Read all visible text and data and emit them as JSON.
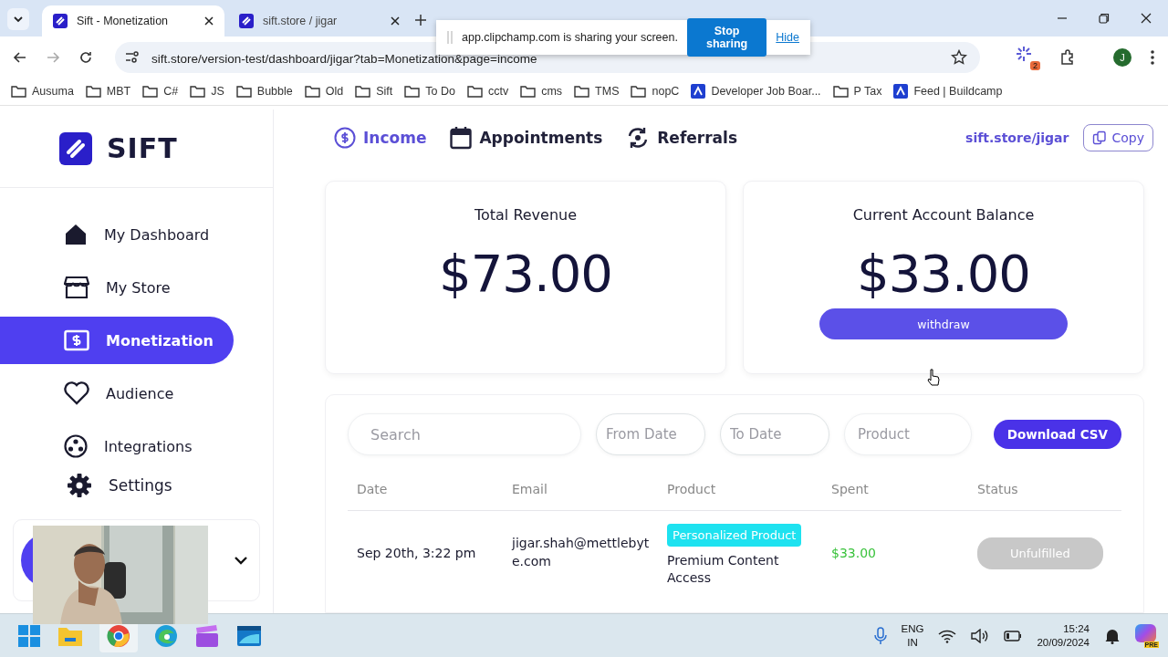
{
  "browser": {
    "tabs": [
      {
        "title": "Sift - Monetization",
        "selected": true
      },
      {
        "title": "sift.store / jigar",
        "selected": false
      }
    ],
    "address": "sift.store/version-test/dashboard/jigar?tab=Monetization&page=income",
    "bookmarks": [
      {
        "label": "Ausuma",
        "kind": "folder"
      },
      {
        "label": "MBT",
        "kind": "folder"
      },
      {
        "label": "C#",
        "kind": "folder"
      },
      {
        "label": "JS",
        "kind": "folder"
      },
      {
        "label": "Bubble",
        "kind": "folder"
      },
      {
        "label": "Old",
        "kind": "folder"
      },
      {
        "label": "Sift",
        "kind": "folder"
      },
      {
        "label": "To Do",
        "kind": "folder"
      },
      {
        "label": "cctv",
        "kind": "folder"
      },
      {
        "label": "cms",
        "kind": "folder"
      },
      {
        "label": "TMS",
        "kind": "folder"
      },
      {
        "label": "nopC",
        "kind": "folder"
      },
      {
        "label": "Developer Job Boar...",
        "kind": "site"
      },
      {
        "label": "P Tax",
        "kind": "folder"
      },
      {
        "label": "Feed | Buildcamp",
        "kind": "site"
      }
    ],
    "extension_badge": "2",
    "profile_initial": "J"
  },
  "share_bar": {
    "message": "app.clipchamp.com is sharing your screen.",
    "stop_button": "Stop sharing",
    "hide_link": "Hide"
  },
  "sidebar": {
    "logo": "SIFT",
    "items": [
      {
        "label": "My Dashboard",
        "selected": false
      },
      {
        "label": "My Store",
        "selected": false
      },
      {
        "label": "Monetization",
        "selected": true
      },
      {
        "label": "Audience",
        "selected": false
      },
      {
        "label": "Integrations",
        "selected": false
      },
      {
        "label": "Settings",
        "selected": false
      }
    ]
  },
  "top_nav": {
    "tabs": [
      {
        "label": "Income",
        "selected": true
      },
      {
        "label": "Appointments",
        "selected": false
      },
      {
        "label": "Referrals",
        "selected": false
      }
    ],
    "store_link": "sift.store/jigar",
    "copy_button": "Copy"
  },
  "cards": [
    {
      "title": "Total Revenue",
      "amount": "$73.00"
    },
    {
      "title": "Current Account Balance",
      "amount": "$33.00",
      "button": "withdraw"
    }
  ],
  "filters": {
    "search_placeholder": "Search",
    "from_placeholder": "From Date",
    "to_placeholder": "To Date",
    "product_placeholder": "Product",
    "download_button": "Download CSV"
  },
  "table": {
    "columns": [
      "Date",
      "Email",
      "Product",
      "Spent",
      "Status"
    ],
    "rows": [
      {
        "date": "Sep 20th, 3:22 pm",
        "email": "jigar.shah@mettlebyte.com",
        "product_tag": "Personalized Product",
        "product": "Premium Content Access",
        "spent": "$33.00",
        "status": "Unfulfilled"
      }
    ]
  },
  "taskbar": {
    "language": [
      "ENG",
      "IN"
    ],
    "time": "15:24",
    "date": "20/09/2024",
    "copilot_badge": "PRE"
  }
}
